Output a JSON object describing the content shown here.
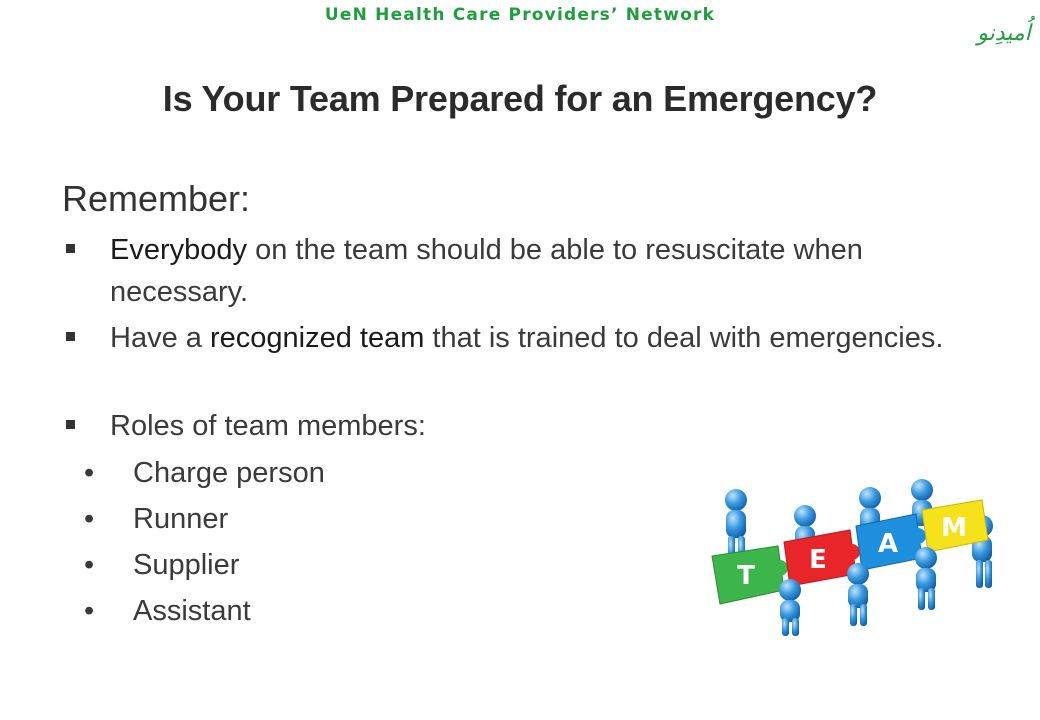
{
  "header": {
    "network": "UeN Health Care Providers’ Network",
    "logo_text": "اُمیدِنو"
  },
  "slide": {
    "title": "Is Your Team Prepared for an Emergency?",
    "remember": "Remember:",
    "bullets": [
      {
        "emph": "Everybody",
        "rest": " on the team should be able to resuscitate when necessary."
      },
      {
        "pre": "Have a ",
        "emph": "recognized team",
        "rest": " that is trained to deal with emergencies."
      },
      {
        "text": "Roles of team members:"
      }
    ],
    "roles": [
      "Charge person",
      "Runner",
      "Supplier",
      "Assistant"
    ],
    "bullet_glyph": "•"
  },
  "illustration": {
    "letters": [
      "T",
      "E",
      "A",
      "M"
    ],
    "colors": {
      "green": "#3cb54a",
      "red": "#e8262a",
      "blue": "#1e8fdc",
      "yellow": "#f6e21a",
      "figure": "#3b9be0",
      "brand_green": "#1f9e3e"
    }
  }
}
